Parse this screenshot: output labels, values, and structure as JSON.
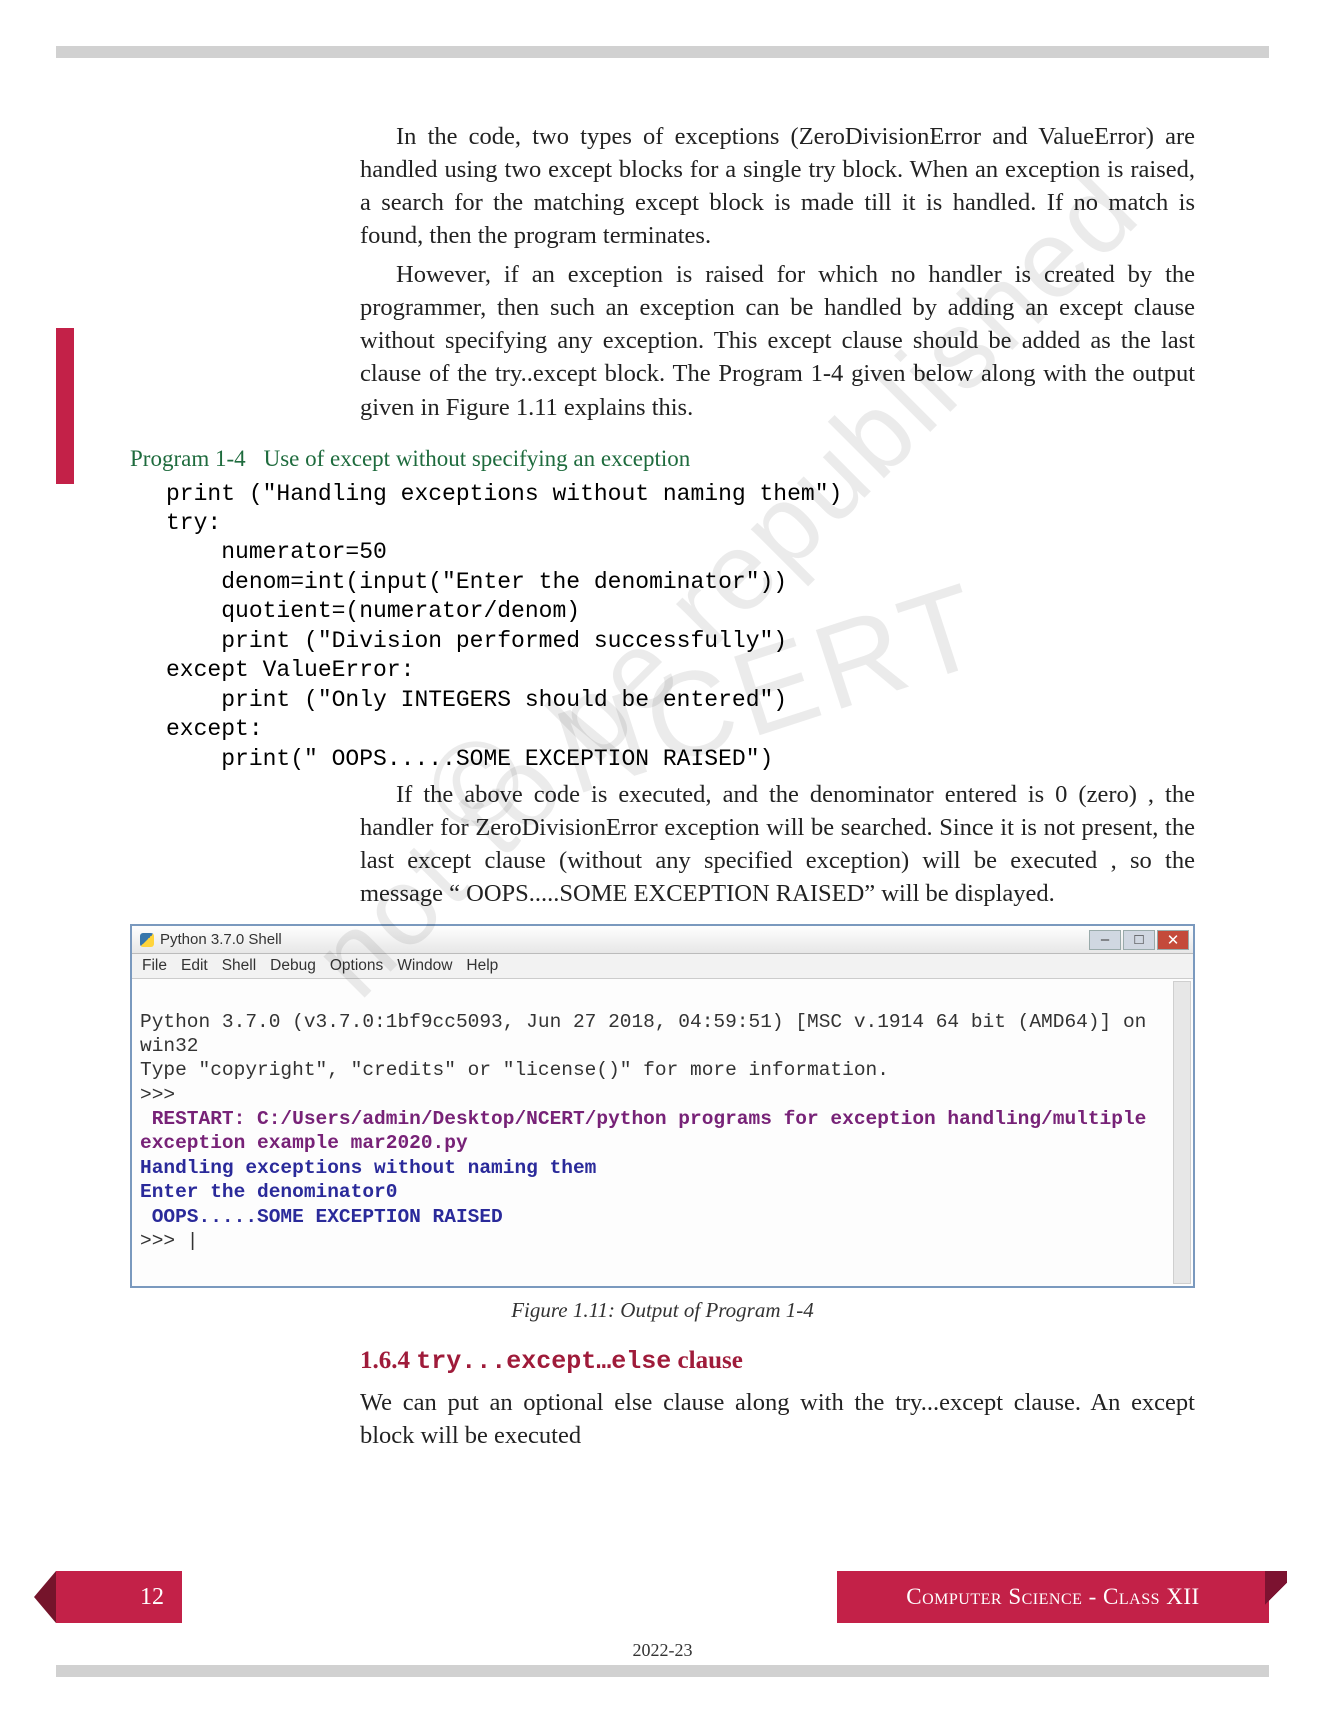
{
  "paragraphs": {
    "p1": "In the code, two types of exceptions (ZeroDivisionError and ValueError) are handled using two except blocks for a single try block. When an exception is raised, a search for the matching except block is made till it is handled. If no match is found, then the program terminates.",
    "p2": "However, if an exception is raised for which no handler is created by the programmer, then such an exception can be handled by adding an except clause without specifying any exception. This except clause should be added as the last clause of the try..except block. The Program 1-4 given below along with the output given in Figure 1.11 explains this.",
    "p1_inline": {
      "ValueError": "ValueError",
      "except": "except",
      "try": "try"
    }
  },
  "program": {
    "label": "Program 1-4",
    "title": "Use of except without specifying an exception",
    "code": "print (\"Handling exceptions without naming them\")\ntry:\n    numerator=50\n    denom=int(input(\"Enter the denominator\"))\n    quotient=(numerator/denom)\n    print (\"Division performed successfully\")\nexcept ValueError:\n    print (\"Only INTEGERS should be entered\")\nexcept:\n    print(\" OOPS.....SOME EXCEPTION RAISED\")"
  },
  "para3": "If the above code is executed, and the denominator entered is 0 (zero) , the handler for ZeroDivisionError exception will be searched. Since it is not present, the last except clause (without any specified exception) will be executed , so the message “ OOPS.....SOME EXCEPTION RAISED” will be displayed.",
  "para3_inline": {
    "ZeroDivisionError": "ZeroDivisionError"
  },
  "shell": {
    "title": "Python 3.7.0 Shell",
    "menu": [
      "File",
      "Edit",
      "Shell",
      "Debug",
      "Options",
      "Window",
      "Help"
    ],
    "line1": "Python 3.7.0 (v3.7.0:1bf9cc5093, Jun 27 2018, 04:59:51) [MSC v.1914 64 bit (AMD64)] on win32",
    "line2": "Type \"copyright\", \"credits\" or \"license()\" for more information.",
    "prompt1": ">>>",
    "restart": " RESTART: C:/Users/admin/Desktop/NCERT/python programs for exception handling/multiple exception example mar2020.py",
    "out1": "Handling exceptions without naming them",
    "out2": "Enter the denominator0",
    "out3": " OOPS.....SOME EXCEPTION RAISED",
    "prompt2": ">>> |"
  },
  "figure_caption": "Figure 1.11: Output of Program 1-4",
  "subsection": {
    "num": "1.6.4",
    "code": "try...except…else",
    "tail": " clause"
  },
  "para4": "We can put an optional else clause along with the try...except clause. An except block will be executed",
  "para4_inline": {
    "else": "else",
    "tryexcept": "try...except",
    "except": "except"
  },
  "footer": {
    "page": "12",
    "book": "Computer Science - Class XII",
    "year": "2022-23"
  },
  "watermarks": {
    "w1": "© NCERT",
    "w2": "not to be republished"
  }
}
